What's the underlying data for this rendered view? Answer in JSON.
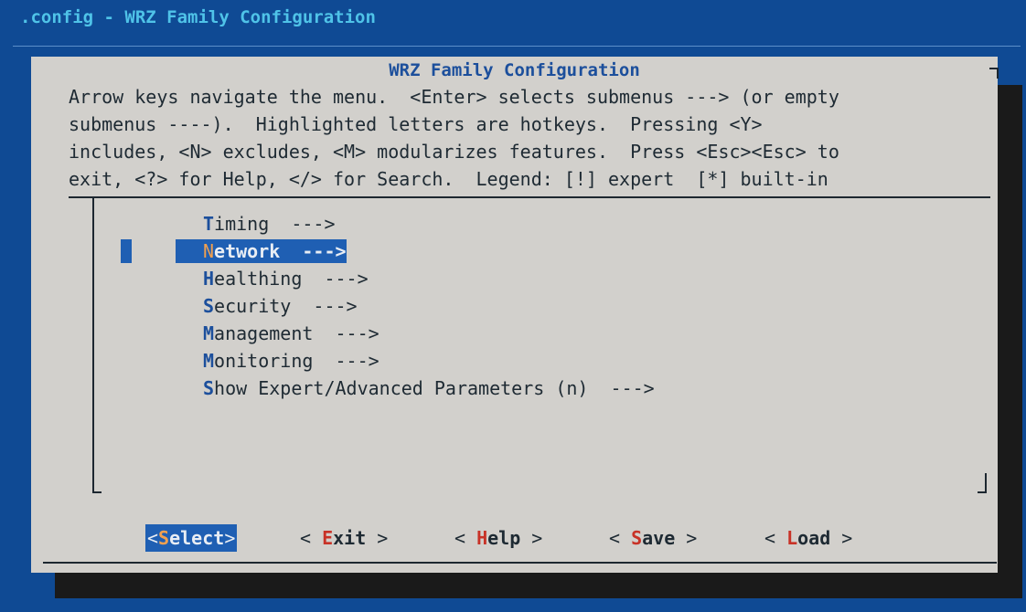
{
  "window_title": ".config - WRZ Family Configuration",
  "dialog": {
    "title": "WRZ Family Configuration",
    "help_lines": [
      "Arrow keys navigate the menu.  <Enter> selects submenus ---> (or empty",
      "submenus ----).  Highlighted letters are hotkeys.  Pressing <Y>",
      "includes, <N> excludes, <M> modularizes features.  Press <Esc><Esc> to",
      "exit, <?> for Help, </> for Search.  Legend: [!] expert  [*] built-in"
    ]
  },
  "menu": {
    "selected_index": 1,
    "items": [
      {
        "hotkey": "T",
        "rest": "iming",
        "suffix": "  --->"
      },
      {
        "hotkey": "N",
        "rest": "etwork",
        "suffix": "  --->"
      },
      {
        "hotkey": "H",
        "rest": "ealthing",
        "suffix": "  --->"
      },
      {
        "hotkey": "S",
        "rest": "ecurity",
        "suffix": "  --->"
      },
      {
        "hotkey": "M",
        "rest": "anagement",
        "suffix": "  --->"
      },
      {
        "hotkey": "M",
        "rest": "onitoring",
        "suffix": "  --->"
      },
      {
        "hotkey": "S",
        "rest": "how Expert/Advanced Parameters (n)",
        "suffix": "  --->"
      }
    ]
  },
  "buttons": [
    {
      "pre": "<",
      "hotkey": "S",
      "rest": "elect",
      "post": ">",
      "active": true
    },
    {
      "pre": "< ",
      "hotkey": "E",
      "rest": "xit",
      "post": " >",
      "active": false
    },
    {
      "pre": "< ",
      "hotkey": "H",
      "rest": "elp",
      "post": " >",
      "active": false
    },
    {
      "pre": "< ",
      "hotkey": "S",
      "rest": "ave",
      "post": " >",
      "active": false
    },
    {
      "pre": "< ",
      "hotkey": "L",
      "rest": "oad",
      "post": " >",
      "active": false
    }
  ],
  "colors": {
    "background": "#0f4a94",
    "dialog": "#d2d0cc",
    "highlight": "#1f5fb3",
    "hotkey_menu": "#1c4f9c",
    "hotkey_button": "#c83227",
    "hotkey_selected": "#f0a050"
  }
}
